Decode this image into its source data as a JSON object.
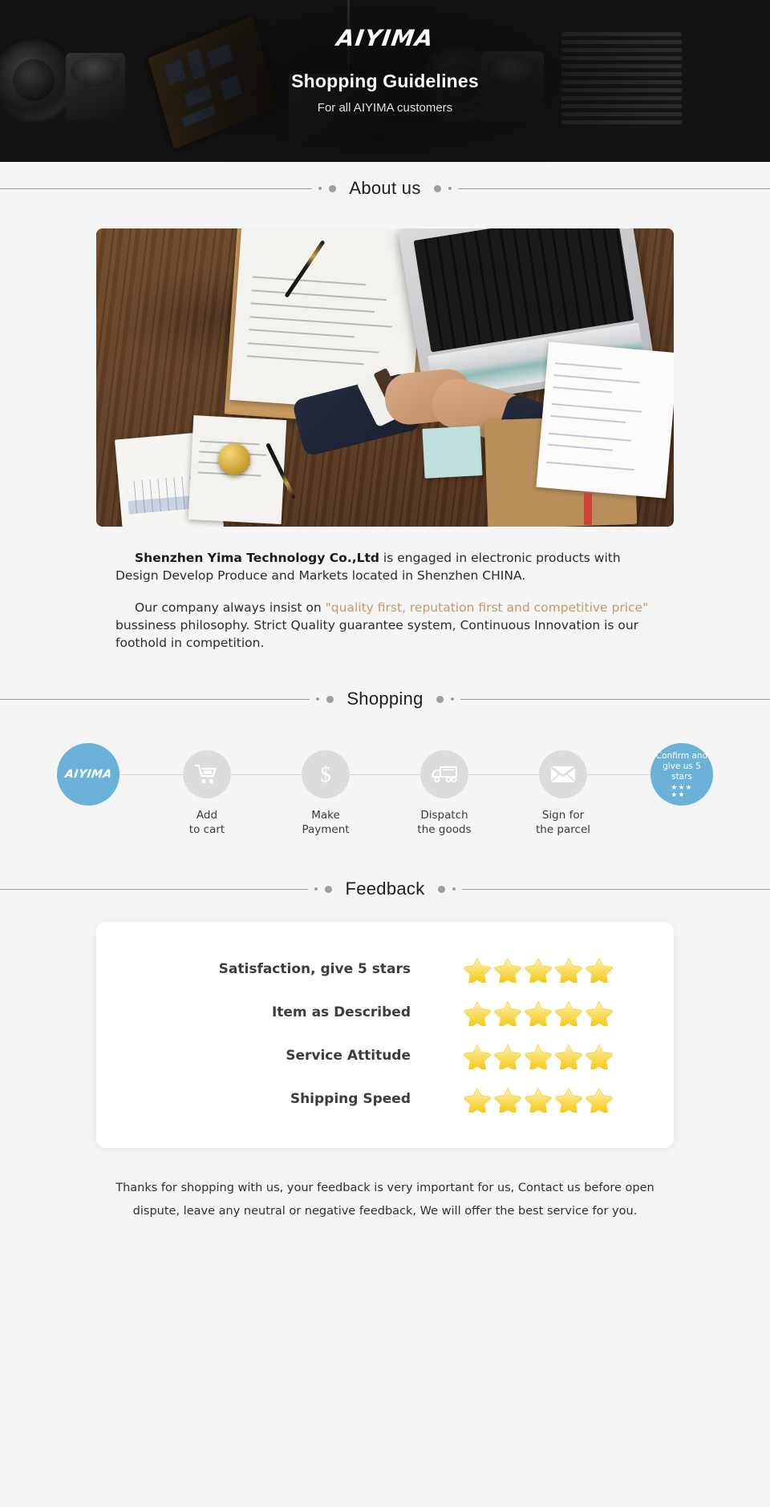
{
  "hero": {
    "logo": "AIYIMA",
    "title": "Shopping Guidelines",
    "subtitle": "For all AIYIMA customers"
  },
  "sections": {
    "about": {
      "title": "About us"
    },
    "shopping": {
      "title": "Shopping"
    },
    "feedback": {
      "title": "Feedback"
    }
  },
  "about": {
    "p1_strong": "Shenzhen Yima Technology Co.,Ltd",
    "p1_rest": " is engaged in electronic products with Design Develop Produce and Markets located in Shenzhen CHINA.",
    "p2_before": "Our company always insist on ",
    "p2_quote": "\"quality first, reputation first and competitive price\"",
    "p2_after": " bussiness philosophy. Strict Quality guarantee system, Continuous Innovation is our foothold in competition."
  },
  "shopping": {
    "steps": [
      {
        "icon": "aiyima-logo-icon",
        "logo": "AIYIMA",
        "label": "",
        "type": "brand"
      },
      {
        "icon": "shopping-cart-icon",
        "label_line1": "Add",
        "label_line2": "to cart",
        "type": "plain"
      },
      {
        "icon": "dollar-icon",
        "label_line1": "Make",
        "label_line2": "Payment",
        "type": "plain"
      },
      {
        "icon": "truck-icon",
        "label_line1": "Dispatch",
        "label_line2": "the goods",
        "type": "plain"
      },
      {
        "icon": "envelope-icon",
        "label_line1": "Sign for",
        "label_line2": "the parcel",
        "type": "plain"
      },
      {
        "icon": "confirm-stars-icon",
        "confirm_line1": "Confirm and",
        "confirm_line2": "give us 5 stars",
        "stars_top": "★★★",
        "stars_bottom": "★★",
        "type": "confirm"
      }
    ]
  },
  "feedback": {
    "rows": [
      {
        "label": "Satisfaction, give 5 stars",
        "stars": 5
      },
      {
        "label": "Item as Described",
        "stars": 5
      },
      {
        "label": "Service Attitude",
        "stars": 5
      },
      {
        "label": "Shipping Speed",
        "stars": 5
      }
    ],
    "note_line1": "Thanks for shopping with us, your feedback is very important for us, Contact us before open",
    "note_line2": "dispute, leave any neutral or negative feedback, We will offer the best service for you."
  },
  "colors": {
    "page_bg": "#f5f5f5",
    "hero_bg": "#161616",
    "accent_blue": "#6ab2d8",
    "quote_brown": "#c49a6c",
    "star_gold": "#f7d33e",
    "circle_gray": "#dcdcdc"
  }
}
